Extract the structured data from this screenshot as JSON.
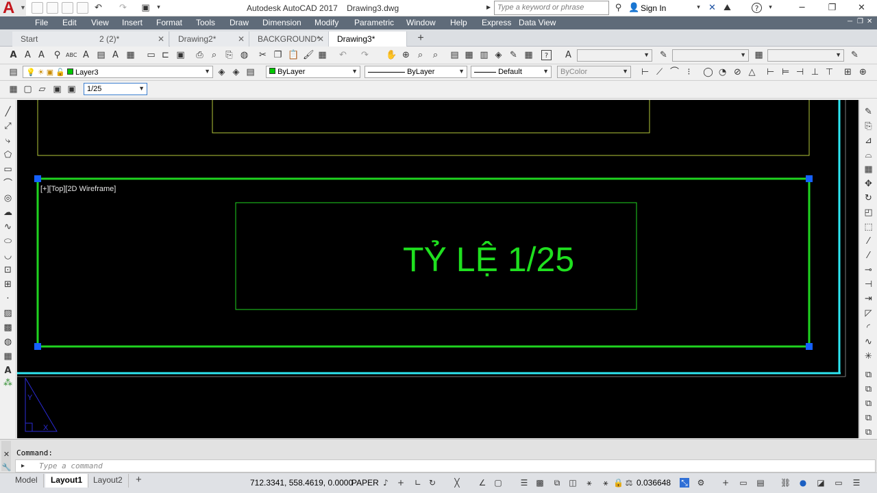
{
  "titlebar": {
    "app_title": "Autodesk AutoCAD 2017",
    "file_name": "Drawing3.dwg",
    "search_placeholder": "Type a keyword or phrase",
    "sign_in": "Sign In"
  },
  "menu": [
    "File",
    "Edit",
    "View",
    "Insert",
    "Format",
    "Tools",
    "Draw",
    "Dimension",
    "Modify",
    "Parametric",
    "Window",
    "Help",
    "Express",
    "Data View"
  ],
  "file_tabs": [
    {
      "label": "Start",
      "active": false
    },
    {
      "label": "2 (2)*",
      "active": false
    },
    {
      "label": "Drawing2*",
      "active": false
    },
    {
      "label": "BACKGROUND*",
      "active": false
    },
    {
      "label": "Drawing3*",
      "active": true
    }
  ],
  "toolbars": {
    "layer": "Layer3",
    "color": "ByLayer",
    "linetype": "ByLayer",
    "lineweight": "Default",
    "plotstyle": "ByColor",
    "viewport_scale": "1/25"
  },
  "viewport": {
    "label": "[+][Top][2D Wireframe]",
    "text": "TỶ LỆ 1/25"
  },
  "command": {
    "history": "Command:",
    "placeholder": "Type a command"
  },
  "layout_tabs": [
    {
      "label": "Model",
      "active": false
    },
    {
      "label": "Layout1",
      "active": true
    },
    {
      "label": "Layout2",
      "active": false
    }
  ],
  "status": {
    "coords": "712.3341, 558.4619, 0.0000",
    "space": "PAPER",
    "scale": "0.036648"
  },
  "colors": {
    "menubar": "#5f6b79",
    "viewport_border": "#1fd31f",
    "paper_border": "#2ee6f2",
    "grip": "#1560ff",
    "geometry": "#b5c93a",
    "text_green": "#1fe01f",
    "ucs_icon": "#2b2bd6"
  }
}
